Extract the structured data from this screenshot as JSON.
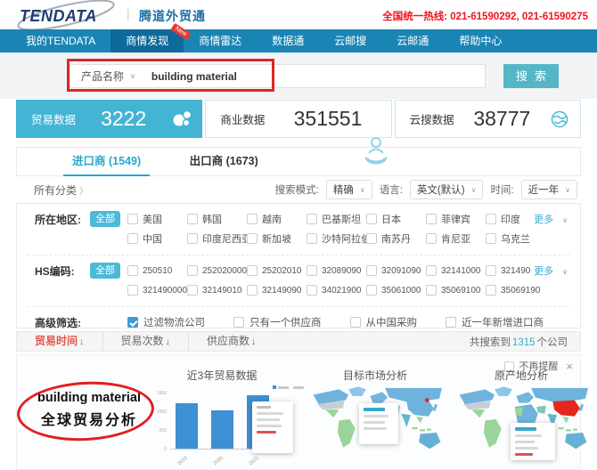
{
  "header": {
    "logo": "TENDATA",
    "product_name": "腾道外贸通",
    "divider": "|",
    "hotline": "全国统一热线: 021-61590292, 021-61590275"
  },
  "icons": {
    "chevron_down": "∨",
    "chevron_right": "〉",
    "close": "×"
  },
  "nav": {
    "badge": "New",
    "items": [
      {
        "label": "我的TENDATA"
      },
      {
        "label": "商情发现"
      },
      {
        "label": "商情雷达"
      },
      {
        "label": "数据通"
      },
      {
        "label": "云邮搜"
      },
      {
        "label": "云邮通"
      },
      {
        "label": "帮助中心"
      }
    ]
  },
  "search": {
    "field_label": "产品名称",
    "query": "building material",
    "button": "搜索"
  },
  "stats": [
    {
      "label": "贸易数据",
      "value": "3222",
      "icon": "cluster-icon"
    },
    {
      "label": "商业数据",
      "value": "351551"
    },
    {
      "label": "云搜数据",
      "value": "38777",
      "icon": "globe-icon"
    }
  ],
  "tabs": [
    {
      "label": "进口商",
      "count": "(1549)"
    },
    {
      "label": "出口商",
      "count": "(1673)"
    }
  ],
  "category_link": "所有分类",
  "search_options": [
    {
      "label": "搜索模式:",
      "value": "精确"
    },
    {
      "label": "语言:",
      "value": "英文(默认)"
    },
    {
      "label": "时间:",
      "value": "近一年"
    }
  ],
  "filters": {
    "region": {
      "label": "所在地区:",
      "all": "全部",
      "more": "更多",
      "row1": [
        "美国",
        "韩国",
        "越南",
        "巴基斯坦",
        "日本",
        "菲律宾",
        "印度"
      ],
      "row2": [
        "中国",
        "印度尼西亚",
        "新加坡",
        "沙特阿拉伯",
        "南苏丹",
        "肯尼亚",
        "乌克兰"
      ]
    },
    "hs": {
      "label": "HS编码:",
      "all": "全部",
      "more": "更多",
      "row1": [
        "250510",
        "2520200000",
        "25202010",
        "32089090",
        "32091090",
        "32141000",
        "321490"
      ],
      "row2": [
        "321490000...",
        "32149010",
        "32149090",
        "34021900",
        "35061000",
        "35069100",
        "35069190"
      ]
    },
    "advanced": {
      "label": "高级筛选:",
      "options": [
        {
          "label": "过滤物流公司",
          "checked": true
        },
        {
          "label": "只有一个供应商",
          "checked": false
        },
        {
          "label": "从中国采购",
          "checked": false
        },
        {
          "label": "近一年新增进口商",
          "checked": false
        }
      ]
    }
  },
  "sort_bar": {
    "arrow": "↓",
    "items": [
      {
        "label": "贸易时间"
      },
      {
        "label": "贸易次数"
      },
      {
        "label": "供应商数"
      }
    ],
    "result_prefix": "共搜索到",
    "result_count": "1315",
    "result_suffix": "个公司"
  },
  "charts_panel": {
    "dismiss_label": "不再提醒",
    "annotation": {
      "line1": "building material",
      "line2": "全球贸易分析"
    }
  },
  "chart_data": [
    {
      "type": "bar",
      "title": "近3年贸易数据",
      "categories": [
        "2019",
        "2020",
        "2021"
      ],
      "values": [
        1200,
        1000,
        1400
      ],
      "ylim": [
        0,
        1500
      ],
      "yticks": [
        "0",
        "500",
        "1000",
        "1500"
      ],
      "bar_color": "#3e8fd4",
      "tooltip_visible": true
    },
    {
      "type": "choropleth",
      "title": "目标市场分析",
      "highlighted": "China (red marker)",
      "tooltip_visible": true
    },
    {
      "type": "choropleth",
      "title": "原产地分析",
      "highlighted": "China (red fill)",
      "tooltip_visible": true
    }
  ],
  "colors": {
    "nav_bg": "#1a85b5",
    "nav_active_bg": "#0e6a9b",
    "accent_teal": "#3aabcf",
    "stat_active_bg": "#43b4d4",
    "search_button": "#55b6c6",
    "checked_checkbox": "#3d9bd8",
    "annotation_red": "#dc2723",
    "hotline_red": "#f2141e",
    "sort_active_red": "#e2574d",
    "bar_blue": "#3e8fd4",
    "map_china_red": "#e4281e"
  }
}
